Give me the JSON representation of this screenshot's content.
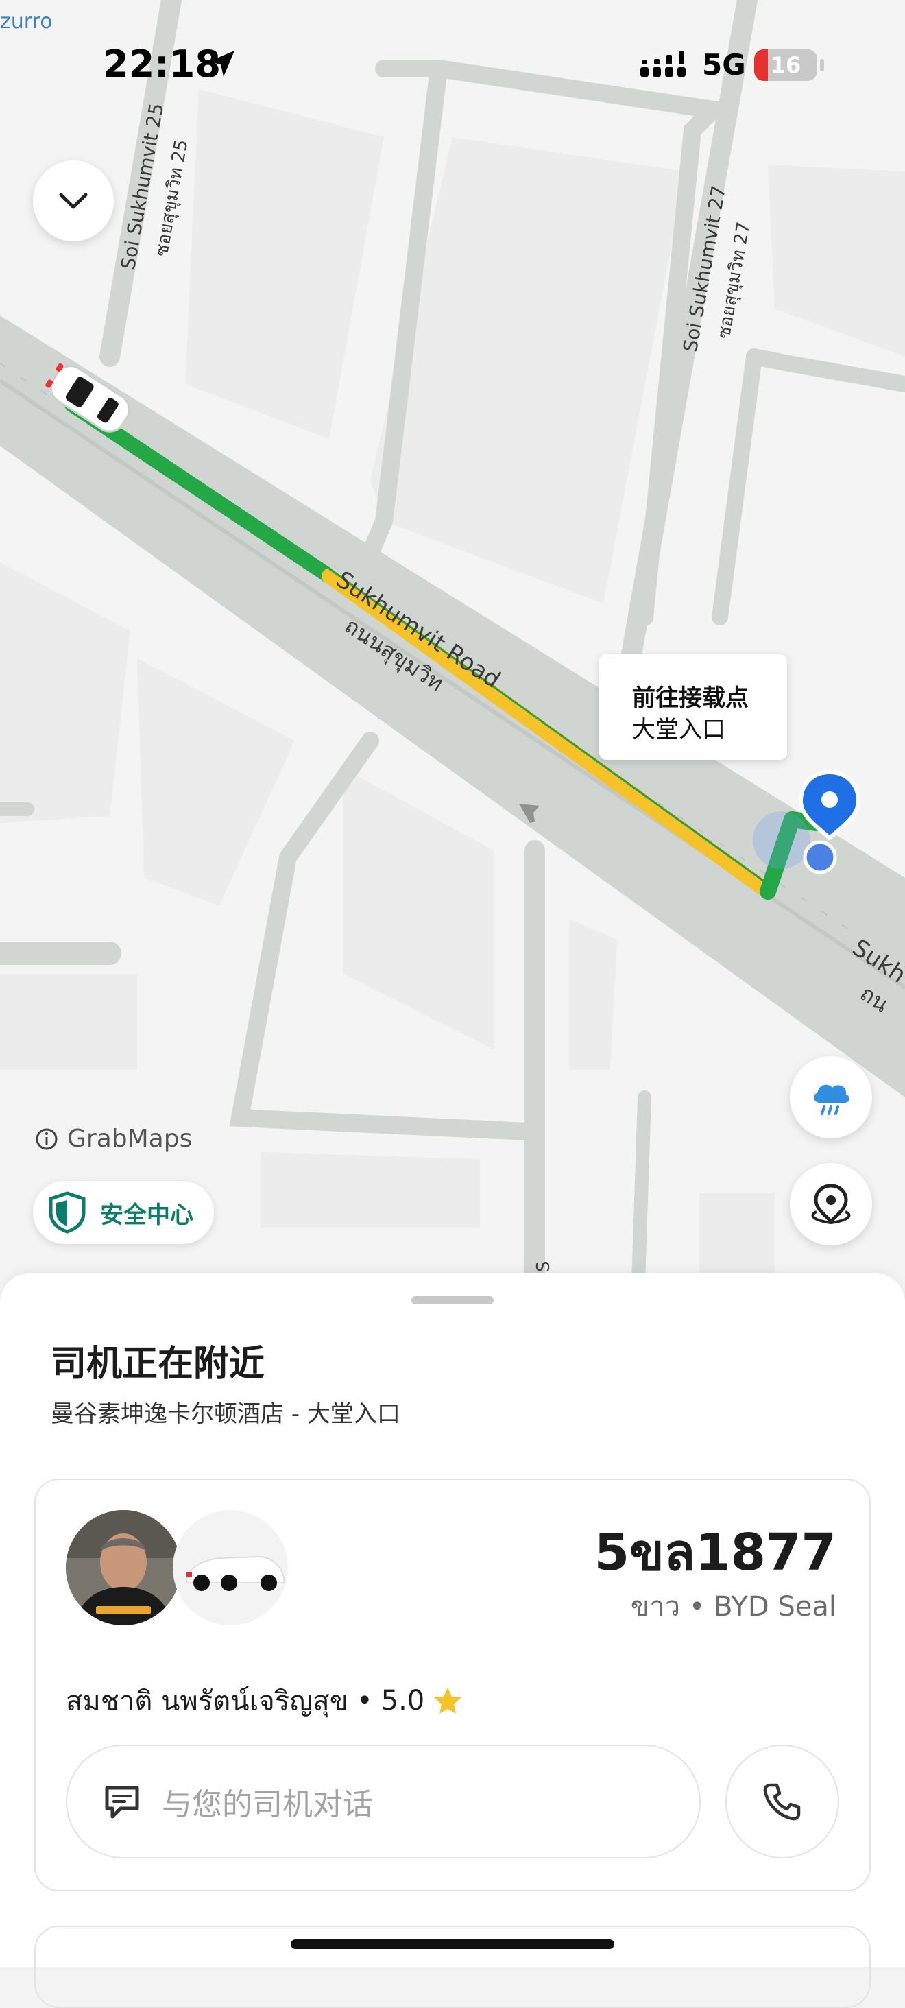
{
  "status_bar": {
    "back_app": "zurro",
    "time": "22:18",
    "network": "5G",
    "battery": "16"
  },
  "map": {
    "streets": {
      "soi25_en": "Soi Sukhumvit 25",
      "soi25_th": "ซอยสุขุมวิท 25",
      "soi27_en": "Soi Sukhumvit 27",
      "soi27_th": "ซอยสุขุมวิท 27",
      "main_en": "Sukhumvit Road",
      "main_th": "ถนนสุขุมวิท",
      "main_en_edge": "Sukh",
      "main_th_edge": "ถน",
      "bottom_edge": "S"
    },
    "pickup_bubble": {
      "line1": "前往接载点",
      "line2": "大堂入口"
    },
    "attribution": "GrabMaps",
    "safety_center": "安全中心",
    "route_colors": {
      "clear": "#23a845",
      "slow": "#f5c329"
    },
    "icons": {
      "collapse": "chevron-down-icon",
      "weather": "rain-cloud-icon",
      "locate": "location-pin-icon",
      "safety": "shield-icon"
    }
  },
  "sheet": {
    "title": "司机正在附近",
    "subtitle": "曼谷素坤逸卡尔顿酒店 - 大堂入口",
    "driver": {
      "plate": "5ขล1877",
      "car": "ขาว • BYD Seal",
      "name": "สมชาติ นพรัตน์เจริญสุข",
      "separator": "•",
      "rating": "5.0"
    },
    "chat_placeholder": "与您的司机对话"
  }
}
